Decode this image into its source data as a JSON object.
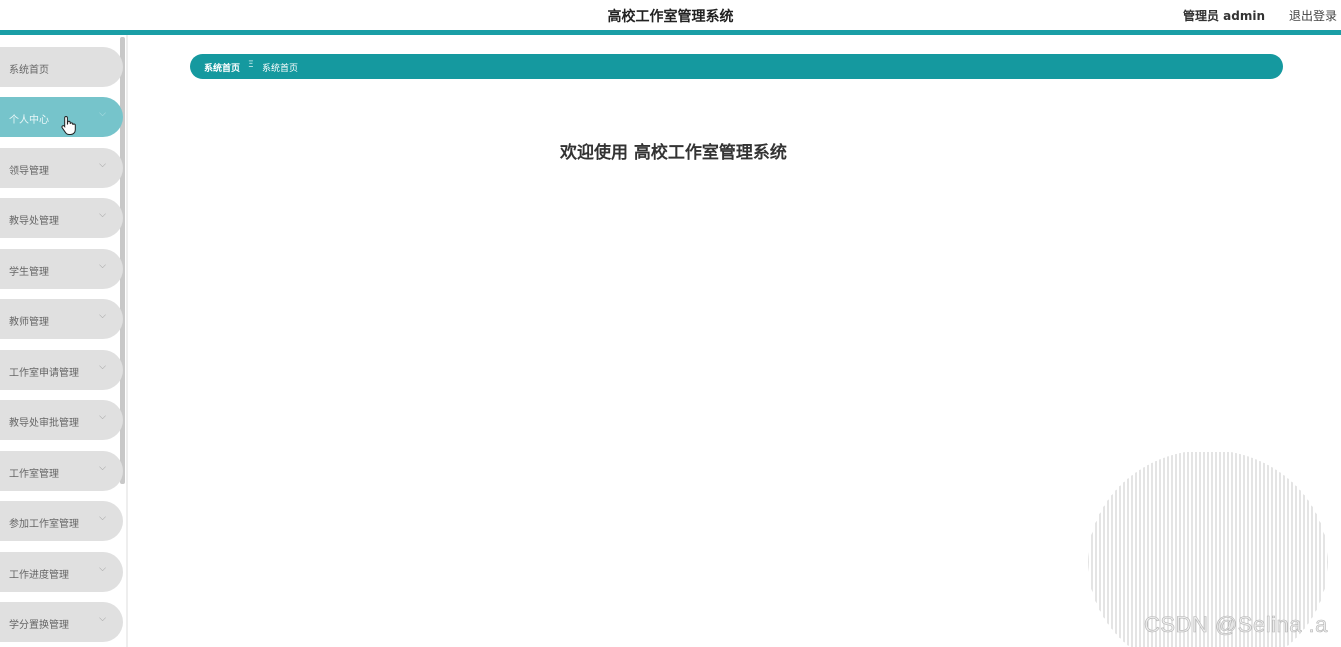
{
  "header": {
    "title": "高校工作室管理系统",
    "admin_label": "管理员 admin",
    "logout": "退出登录"
  },
  "sidebar": {
    "items": [
      {
        "label": "系统首页",
        "has_chevron": false,
        "active": false
      },
      {
        "label": "个人中心",
        "has_chevron": true,
        "active": true
      },
      {
        "label": "领导管理",
        "has_chevron": true,
        "active": false
      },
      {
        "label": "教导处管理",
        "has_chevron": true,
        "active": false
      },
      {
        "label": "学生管理",
        "has_chevron": true,
        "active": false
      },
      {
        "label": "教师管理",
        "has_chevron": true,
        "active": false
      },
      {
        "label": "工作室申请管理",
        "has_chevron": true,
        "active": false
      },
      {
        "label": "教导处审批管理",
        "has_chevron": true,
        "active": false
      },
      {
        "label": "工作室管理",
        "has_chevron": true,
        "active": false
      },
      {
        "label": "参加工作室管理",
        "has_chevron": true,
        "active": false
      },
      {
        "label": "工作进度管理",
        "has_chevron": true,
        "active": false
      },
      {
        "label": "学分置换管理",
        "has_chevron": true,
        "active": false
      }
    ],
    "chevron_icon": "chevron-down-icon"
  },
  "breadcrumb": {
    "home": "系统首页",
    "separator": "Ξ",
    "current": "系统首页"
  },
  "main": {
    "welcome": "欢迎使用 高校工作室管理系统"
  },
  "watermark": "CSDN @Selina .a",
  "colors": {
    "accent": "#15999f",
    "header_line": "#1a9ea6",
    "menu_bg": "#e0e0e0",
    "menu_active_bg": "#76c4cb"
  }
}
